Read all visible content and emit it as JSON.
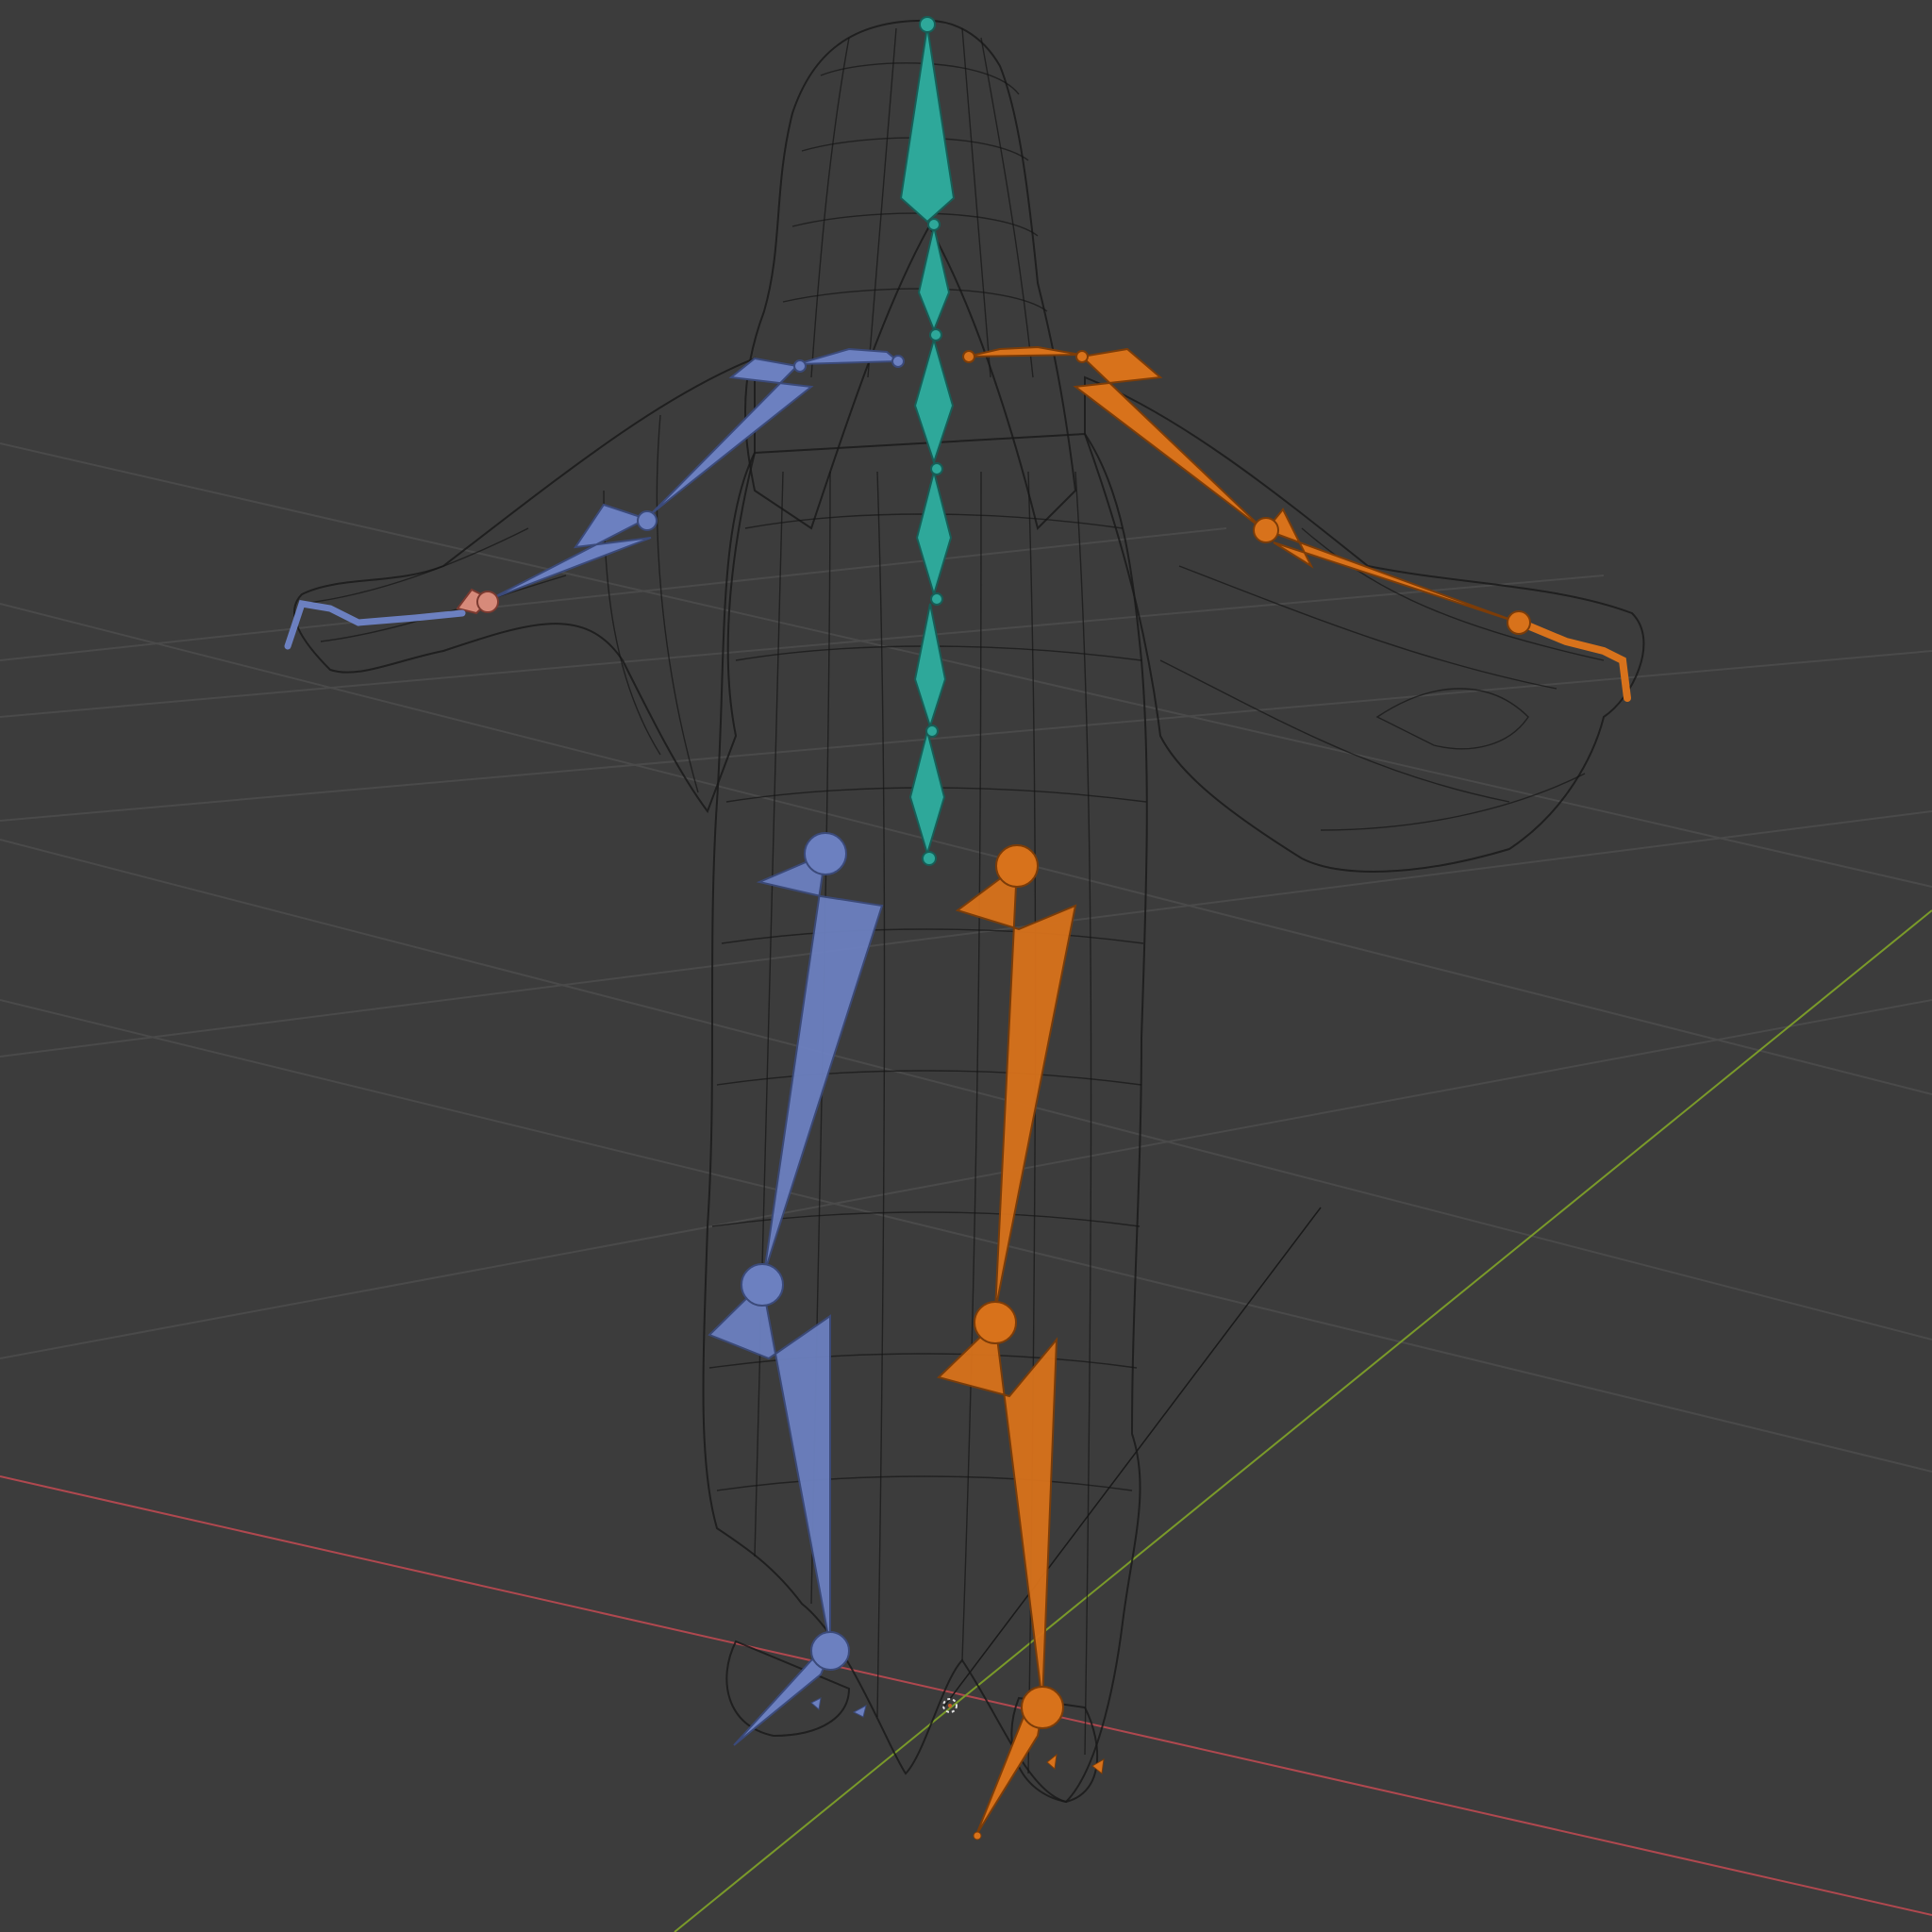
{
  "viewport": {
    "editor": "3D Viewport",
    "shading": "wireframe",
    "colors": {
      "background": "#3c3c3c",
      "grid": "#4a4a4a",
      "x_axis": "#b0484f",
      "y_axis": "#7a9a2a",
      "wireframe": "#141414",
      "bone_center": "#2ea89a",
      "bone_left": "#6c80c0",
      "bone_right": "#d8721b"
    }
  },
  "scene": {
    "objects": [
      {
        "name_shown": false,
        "type": "mesh",
        "icon": "robed-figure-mesh"
      },
      {
        "name_shown": false,
        "type": "armature",
        "icon": "armature-icon"
      }
    ],
    "bone_groups": [
      "center-spine",
      "left-limbs",
      "right-limbs"
    ]
  }
}
